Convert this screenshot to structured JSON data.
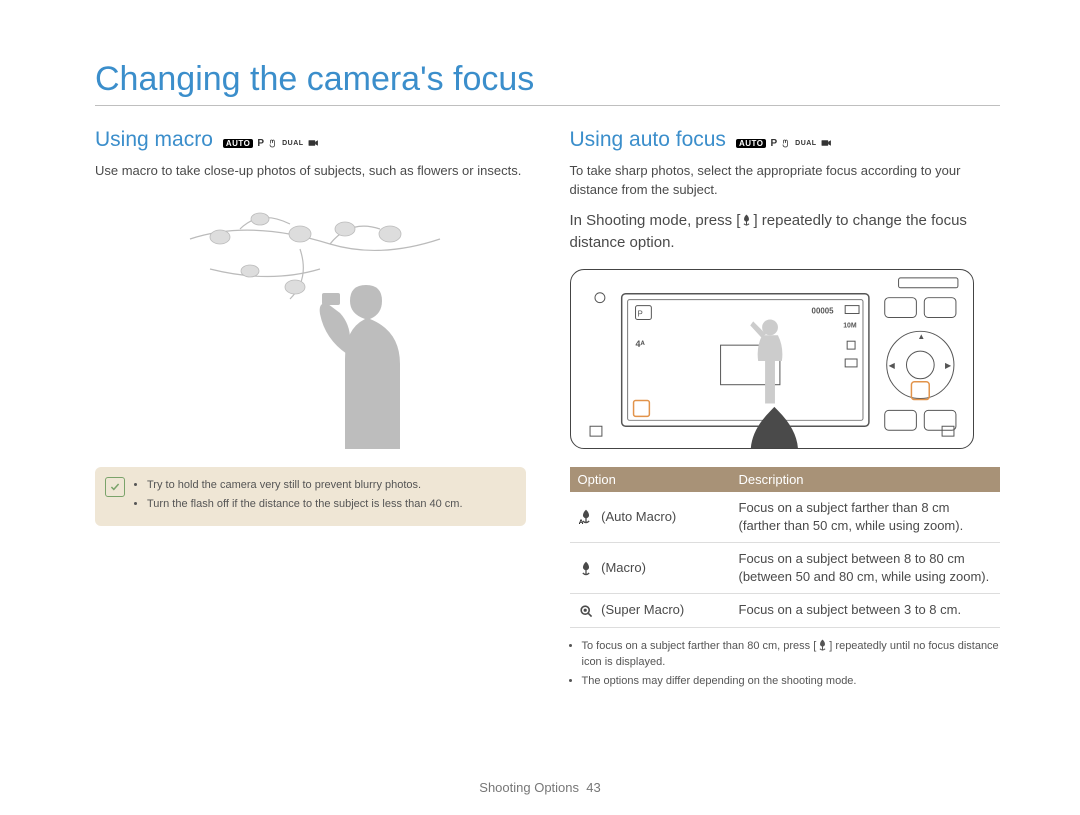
{
  "title": "Changing the camera's focus",
  "footer": {
    "section": "Shooting Options",
    "page": "43"
  },
  "modes": {
    "auto": "AUTO",
    "p": "P",
    "dual": "DUAL"
  },
  "left": {
    "heading": "Using macro",
    "body": "Use macro to take close-up photos of subjects, such as flowers or insects.",
    "note1": "Try to hold the camera very still to prevent blurry photos.",
    "note2": "Turn the flash off if the distance to the subject is less than 40 cm."
  },
  "right": {
    "heading": "Using auto focus",
    "body": "To take sharp photos, select the appropriate focus according to your distance from the subject.",
    "instruction_pre": "In Shooting mode, press [",
    "instruction_post": "] repeatedly to change the focus distance option.",
    "table": {
      "h1": "Option",
      "h2": "Description",
      "rows": [
        {
          "label": "(Auto Macro)",
          "desc": "Focus on a subject farther than 8 cm (farther than 50 cm, while using zoom)."
        },
        {
          "label": "(Macro)",
          "desc": "Focus on a subject between 8 to 80 cm (between 50 and 80 cm, while using zoom)."
        },
        {
          "label": "(Super Macro)",
          "desc": "Focus on a subject between 3 to 8 cm."
        }
      ]
    },
    "foot1_pre": "To focus on a subject farther than 80 cm, press [",
    "foot1_post": "] repeatedly until no focus distance icon is displayed.",
    "foot2": "The options may differ depending on the shooting mode."
  }
}
